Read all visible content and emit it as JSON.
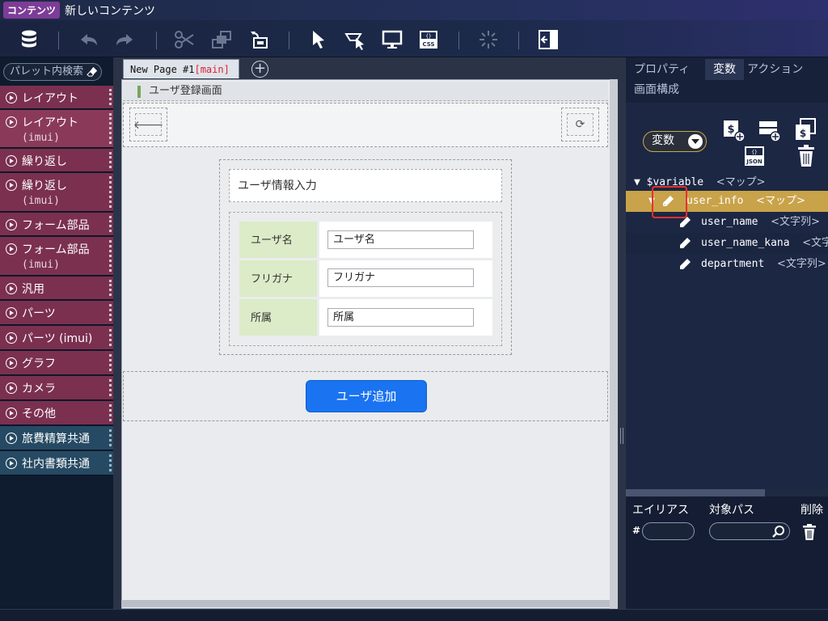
{
  "window": {
    "badge": "コンテンツ",
    "title": "新しいコンテンツ"
  },
  "toolbar": {
    "icons": [
      "database-icon",
      "undo-icon",
      "redo-icon",
      "cut-icon",
      "copy-icon",
      "paste-icon",
      "select-icon",
      "hover-select-icon",
      "preview-icon",
      "css-icon",
      "loading-icon",
      "panel-icon"
    ]
  },
  "palette": {
    "search_placeholder": "パレット内検索",
    "items": [
      {
        "label": "レイアウト",
        "sub": ""
      },
      {
        "label": "レイアウト",
        "sub": "(imui)"
      },
      {
        "label": "繰り返し",
        "sub": ""
      },
      {
        "label": "繰り返し",
        "sub": "(imui)"
      },
      {
        "label": "フォーム部品",
        "sub": ""
      },
      {
        "label": "フォーム部品",
        "sub": "(imui)"
      },
      {
        "label": "汎用",
        "sub": ""
      },
      {
        "label": "パーツ",
        "sub": ""
      },
      {
        "label": "パーツ (imui)",
        "sub": ""
      },
      {
        "label": "グラフ",
        "sub": ""
      },
      {
        "label": "カメラ",
        "sub": ""
      },
      {
        "label": "その他",
        "sub": ""
      },
      {
        "label": "旅費精算共通",
        "sub": ""
      },
      {
        "label": "社内書類共通",
        "sub": ""
      }
    ]
  },
  "editor": {
    "tab_label": "New Page #1",
    "tab_suffix": "[main]",
    "page_title": "ユーザ登録画面",
    "back_glyph": "🡐",
    "reload_glyph": "⟳",
    "form_title": "ユーザ情報入力",
    "fields": [
      {
        "label": "ユーザ名",
        "value": "ユーザ名"
      },
      {
        "label": "フリガナ",
        "value": "フリガナ"
      },
      {
        "label": "所属",
        "value": "所属"
      }
    ],
    "add_button": "ユーザ追加"
  },
  "right_panel": {
    "tabs": [
      "プロパティ",
      "変数",
      "アクション"
    ],
    "active_tab": "変数",
    "screen_tab": "画面構成",
    "var_select": "変数",
    "tree": [
      {
        "name": "$variable",
        "type": "<マップ>",
        "depth": 0
      },
      {
        "name": "user_info",
        "type": "<マップ>",
        "depth": 1,
        "selected": true
      },
      {
        "name": "user_name",
        "type": "<文字列>",
        "depth": 2
      },
      {
        "name": "user_name_kana",
        "type": "<文字列>",
        "depth": 2
      },
      {
        "name": "department",
        "type": "<文字列>",
        "depth": 2
      }
    ],
    "alias_header": "エイリアス",
    "path_header": "対象パス",
    "delete_header": "削除",
    "hash": "#"
  }
}
